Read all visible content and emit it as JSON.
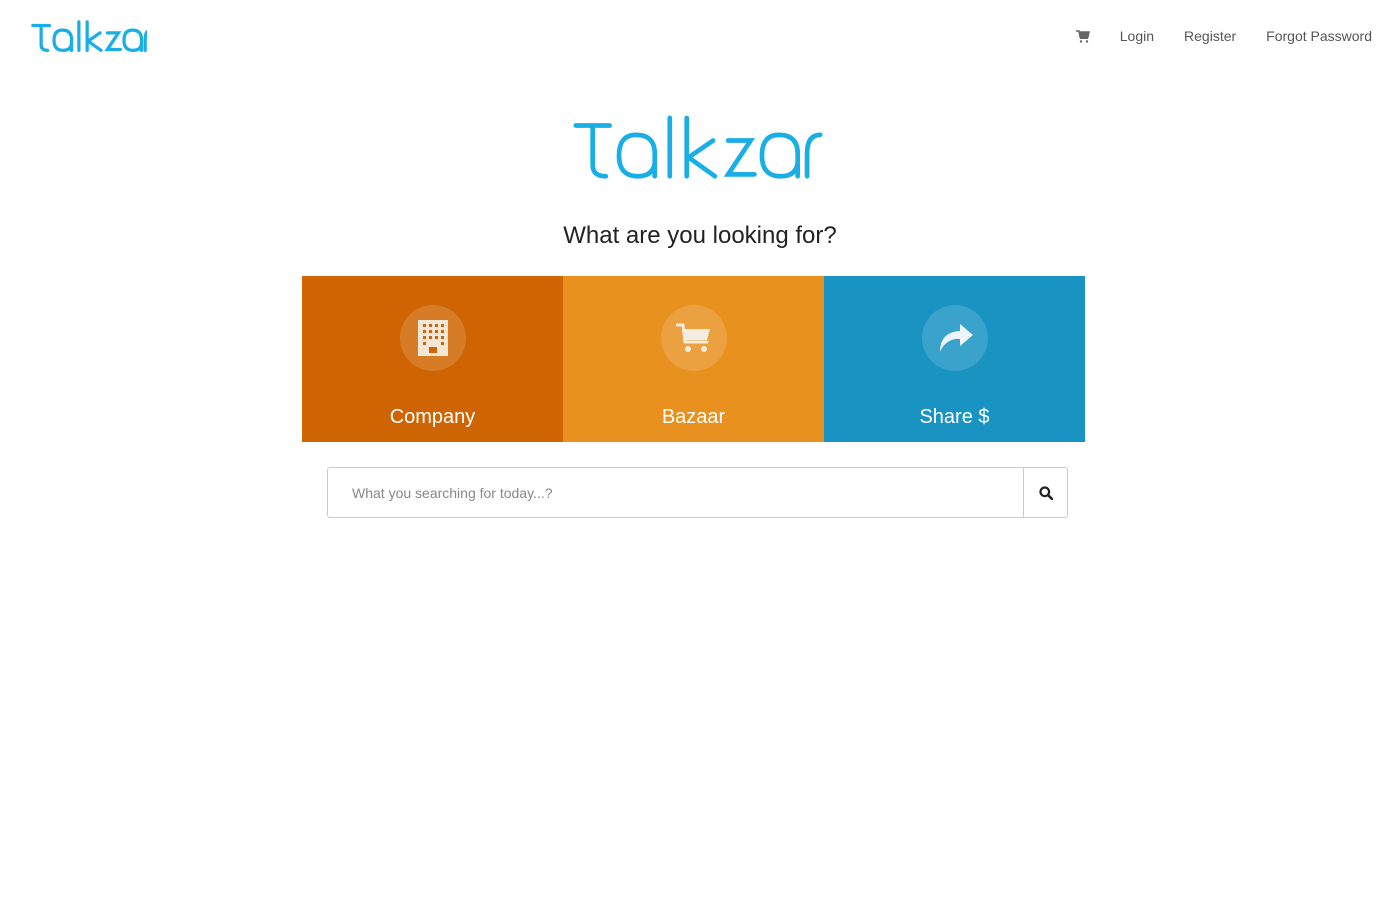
{
  "brand": {
    "name": "Talkzar",
    "color": "#19aee6"
  },
  "nav": {
    "cart_icon": "shopping-cart-icon",
    "links": [
      {
        "label": "Login"
      },
      {
        "label": "Register"
      },
      {
        "label": "Forgot Password"
      }
    ]
  },
  "headline": "What are you looking for?",
  "tiles": [
    {
      "label": "Company",
      "icon": "building-icon",
      "color": "#cf6502"
    },
    {
      "label": "Bazaar",
      "icon": "shopping-cart-icon",
      "color": "#e8911e"
    },
    {
      "label": "Share $",
      "icon": "share-arrow-icon",
      "color": "#1893c2"
    }
  ],
  "search": {
    "placeholder": "What you searching for today...?",
    "value": "",
    "button_icon": "search-icon"
  }
}
